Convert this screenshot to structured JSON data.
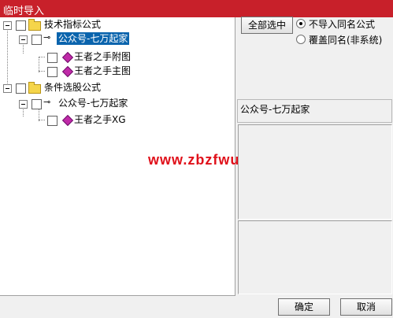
{
  "window": {
    "title": "临时导入"
  },
  "tree": {
    "nodes": [
      {
        "label": "技术指标公式"
      },
      {
        "label": "公众号-七万起家"
      },
      {
        "label": "王者之手附图"
      },
      {
        "label": "王者之手主图"
      },
      {
        "label": "条件选股公式"
      },
      {
        "label": "公众号-七万起家"
      },
      {
        "label": "王者之手XG"
      }
    ]
  },
  "watermark": "www.zbzfwu.com",
  "options": {
    "select_all_label": "全部选中",
    "radio_no_import_label": "不导入同名公式",
    "radio_overwrite_label": "覆盖同名(非系统)"
  },
  "info": {
    "selected_name": "公众号-七万起家"
  },
  "footer": {
    "ok_label": "确定",
    "cancel_label": "取消"
  },
  "colors": {
    "titlebar": "#c8202a",
    "selection": "#0a64ad",
    "watermark": "#e0101a"
  },
  "icons": [
    "folder-icon",
    "key-icon",
    "gem-icon",
    "expander-icon",
    "checkbox-icon",
    "radio-icon"
  ]
}
